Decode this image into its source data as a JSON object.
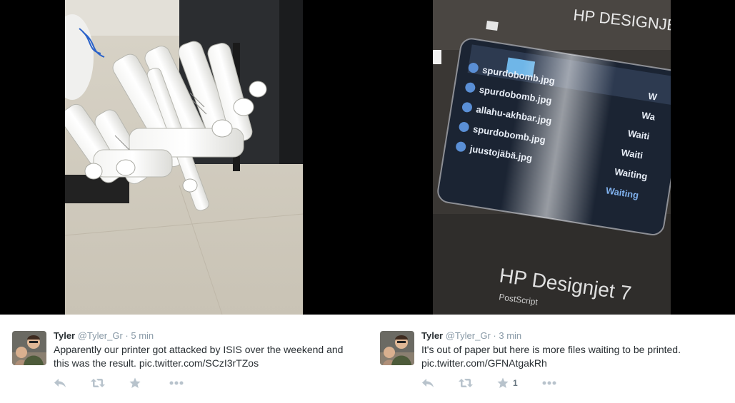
{
  "tweets": [
    {
      "name": "Tyler",
      "handle": "@Tyler_Gr",
      "separator": "·",
      "time": "5 min",
      "text": "Apparently our printer got attacked by ISIS over the weekend and this was the result. pic.twitter.com/SCzI3rTZos",
      "favorite_count": ""
    },
    {
      "name": "Tyler",
      "handle": "@Tyler_Gr",
      "separator": "·",
      "time": "3 min",
      "text": "It's out of paper but here is more files waiting to be printed. pic.twitter.com/GFNAtgakRh",
      "favorite_count": "1"
    }
  ],
  "printer_screen": {
    "brand_top": "HP DESIGNJE",
    "brand_bottom": "HP Designjet 7",
    "brand_sub": "PostScript",
    "jobs": [
      {
        "file": "spurdobomb.jpg",
        "status": "W"
      },
      {
        "file": "spurdobomb.jpg",
        "status": "Wa"
      },
      {
        "file": "allahu-akhbar.jpg",
        "status": "Waiti"
      },
      {
        "file": "spurdobomb.jpg",
        "status": "Waiti"
      },
      {
        "file": "juustojäbä.jpg",
        "status": "Waiting"
      },
      {
        "file": "",
        "status": "Waiting"
      }
    ]
  },
  "colors": {
    "text": "#292f33",
    "muted": "#8899a6",
    "icon": "#b8c3cc"
  }
}
